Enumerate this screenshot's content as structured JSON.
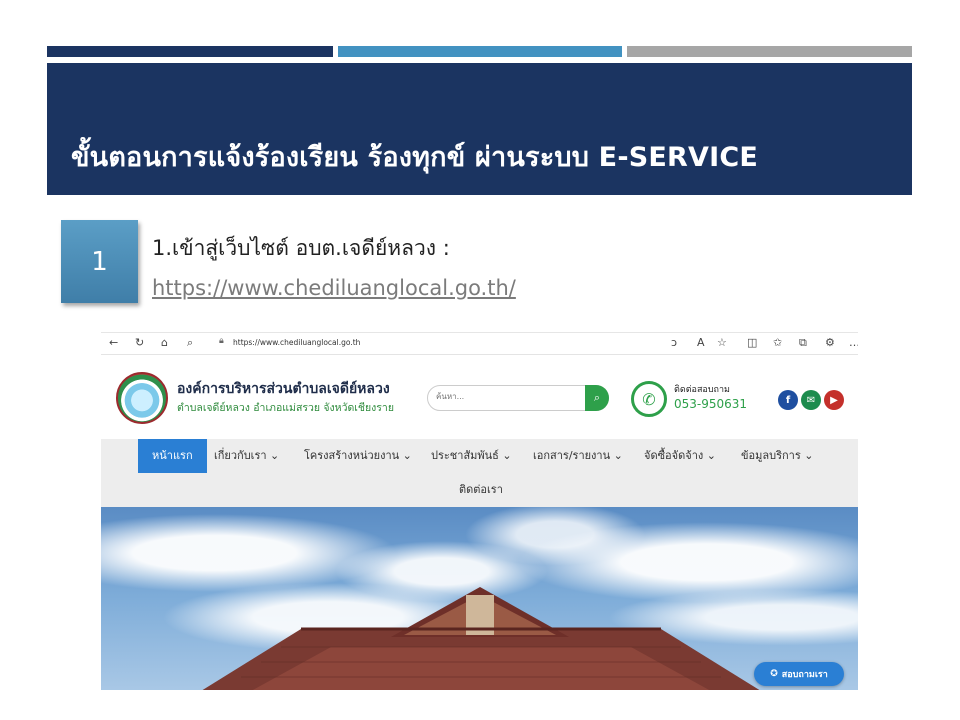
{
  "slide": {
    "title": "ขั้นตอนการแจ้งร้องเรียน ร้องทุกข์ ผ่านระบบ E-SERVICE",
    "step_number": "1",
    "step_text": "1.เข้าสู่เว็บไซต์ อบต.เจดีย์หลวง :",
    "step_link": "https://www.chediluanglocal.go.th/"
  },
  "browser": {
    "url": "https://www.chediluanglocal.go.th"
  },
  "site": {
    "org_name": "องค์การบริหารส่วนตำบลเจดีย์หลวง",
    "org_sub": "ตำบลเจดีย์หลวง อำเภอแม่สรวย จังหวัดเชียงราย",
    "search_placeholder": "ค้นหา...",
    "contact_label": "ติดต่อสอบถาม",
    "contact_phone": "053-950631",
    "chat_label": "สอบถามเรา",
    "nav": [
      {
        "label": "หน้าแรก"
      },
      {
        "label": "เกี่ยวกับเรา ⌄"
      },
      {
        "label": "โครงสร้างหน่วยงาน ⌄"
      },
      {
        "label": "ประชาสัมพันธ์ ⌄"
      },
      {
        "label": "เอกสาร/รายงาน ⌄"
      },
      {
        "label": "จัดซื้อจัดจ้าง ⌄"
      },
      {
        "label": "ข้อมูลบริการ ⌄"
      },
      {
        "label": "ติดต่อเรา"
      }
    ]
  },
  "colors": {
    "title_bg": "#1b3461",
    "accent_blue": "#4292c1",
    "accent_gray": "#a6a6a6",
    "nav_active": "#2a7fd4",
    "brand_green": "#2ea04a"
  }
}
